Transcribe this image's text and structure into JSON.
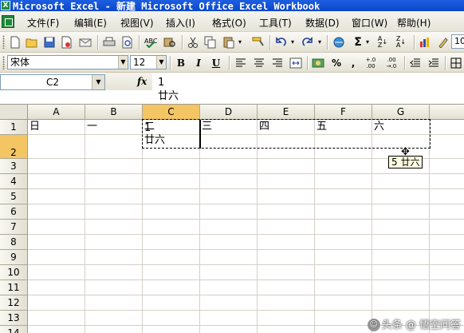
{
  "window": {
    "title": "Microsoft Excel - 新建 Microsoft Office Excel Workbook",
    "app_icon": "X"
  },
  "menu": [
    "文件(F)",
    "编辑(E)",
    "视图(V)",
    "插入(I)",
    "格式(O)",
    "工具(T)",
    "数据(D)",
    "窗口(W)",
    "帮助(H)"
  ],
  "toolbar_standard": {
    "icons": [
      "new-icon",
      "open-icon",
      "save-icon",
      "permission-icon",
      "email-icon",
      "print-icon",
      "print-preview-icon",
      "spelling-icon",
      "research-icon",
      "cut-icon",
      "copy-icon",
      "paste-icon",
      "format-painter-icon",
      "undo-icon",
      "redo-icon",
      "hyperlink-icon",
      "autosum-icon",
      "sort-ascending-icon",
      "sort-descending-icon",
      "chart-wizard-icon",
      "drawing-icon"
    ],
    "zoom": "10"
  },
  "toolbar_formatting": {
    "font_name": "宋体",
    "font_size": "12",
    "bold": "B",
    "italic": "I",
    "underline": "U",
    "percent": "%",
    "comma": ",",
    "increase_decimal": "+.0 .00",
    "decrease_decimal": ".00 →.0"
  },
  "formula_bar": {
    "name_box": "C2",
    "fx_label": "fx",
    "content": "1\n廿六"
  },
  "sheet": {
    "columns": [
      "A",
      "B",
      "C",
      "D",
      "E",
      "F",
      "G"
    ],
    "selected_column": "C",
    "rows": [
      "1",
      "2",
      "3",
      "4",
      "5",
      "6",
      "7",
      "8",
      "9",
      "10",
      "11",
      "12",
      "13",
      "14"
    ],
    "selected_row": "2",
    "row1": [
      "日",
      "一",
      "二",
      "三",
      "四",
      "五",
      "六"
    ],
    "c2": "1\n廿六",
    "fill_tooltip": "5 廿六"
  },
  "watermark": "头条 @ 悟空问答"
}
